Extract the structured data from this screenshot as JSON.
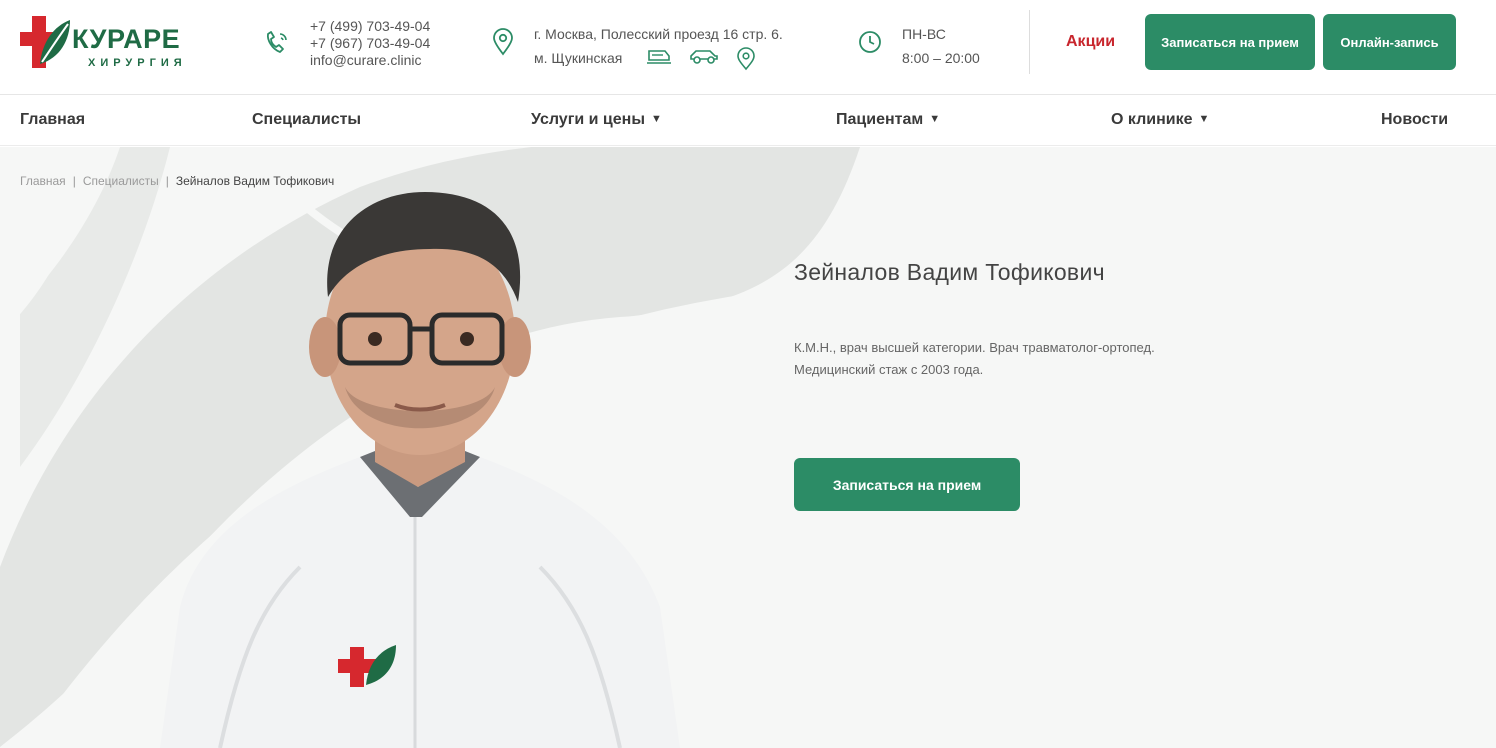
{
  "header": {
    "logo": {
      "name": "КУРАРЕ",
      "subtitle": "ХИРУРГИЯ"
    },
    "phones": [
      "+7 (499) 703-49-04",
      "+7 (967) 703-49-04"
    ],
    "email": "info@curare.clinic",
    "address": {
      "line1": "г. Москва, Полесский проезд 16 стр. 6.",
      "line2": "м. Щукинская"
    },
    "hours": {
      "days": "ПН-ВС",
      "time": "8:00 – 20:00"
    },
    "promo_label": "Акции",
    "book_label": "Записаться на прием",
    "online_label": "Онлайн-запись"
  },
  "nav": {
    "items": [
      {
        "label": "Главная"
      },
      {
        "label": "Специалисты"
      },
      {
        "label": "Услуги и цены"
      },
      {
        "label": "Пациентам"
      },
      {
        "label": "О клинике"
      },
      {
        "label": "Новости"
      }
    ]
  },
  "breadcrumb": [
    "Главная",
    "Специалисты",
    "Зейналов Вадим Тофикович"
  ],
  "doctor": {
    "name": "Зейналов Вадим Тофикович",
    "desc_line1": "К.М.Н., врач высшей категории. Врач травматолог-ортопед.",
    "desc_line2": "Медицинский стаж с 2003 года.",
    "book_label": "Записаться на прием"
  },
  "colors": {
    "brand_green": "#2c8c66",
    "logo_green": "#1f6b45",
    "promo_red": "#c8262d",
    "cross_red": "#d6282e"
  },
  "icons": [
    "phone-icon",
    "location-pin-icon",
    "bus-icon",
    "car-icon",
    "map-pin-icon",
    "clock-icon",
    "caret-down-icon"
  ]
}
